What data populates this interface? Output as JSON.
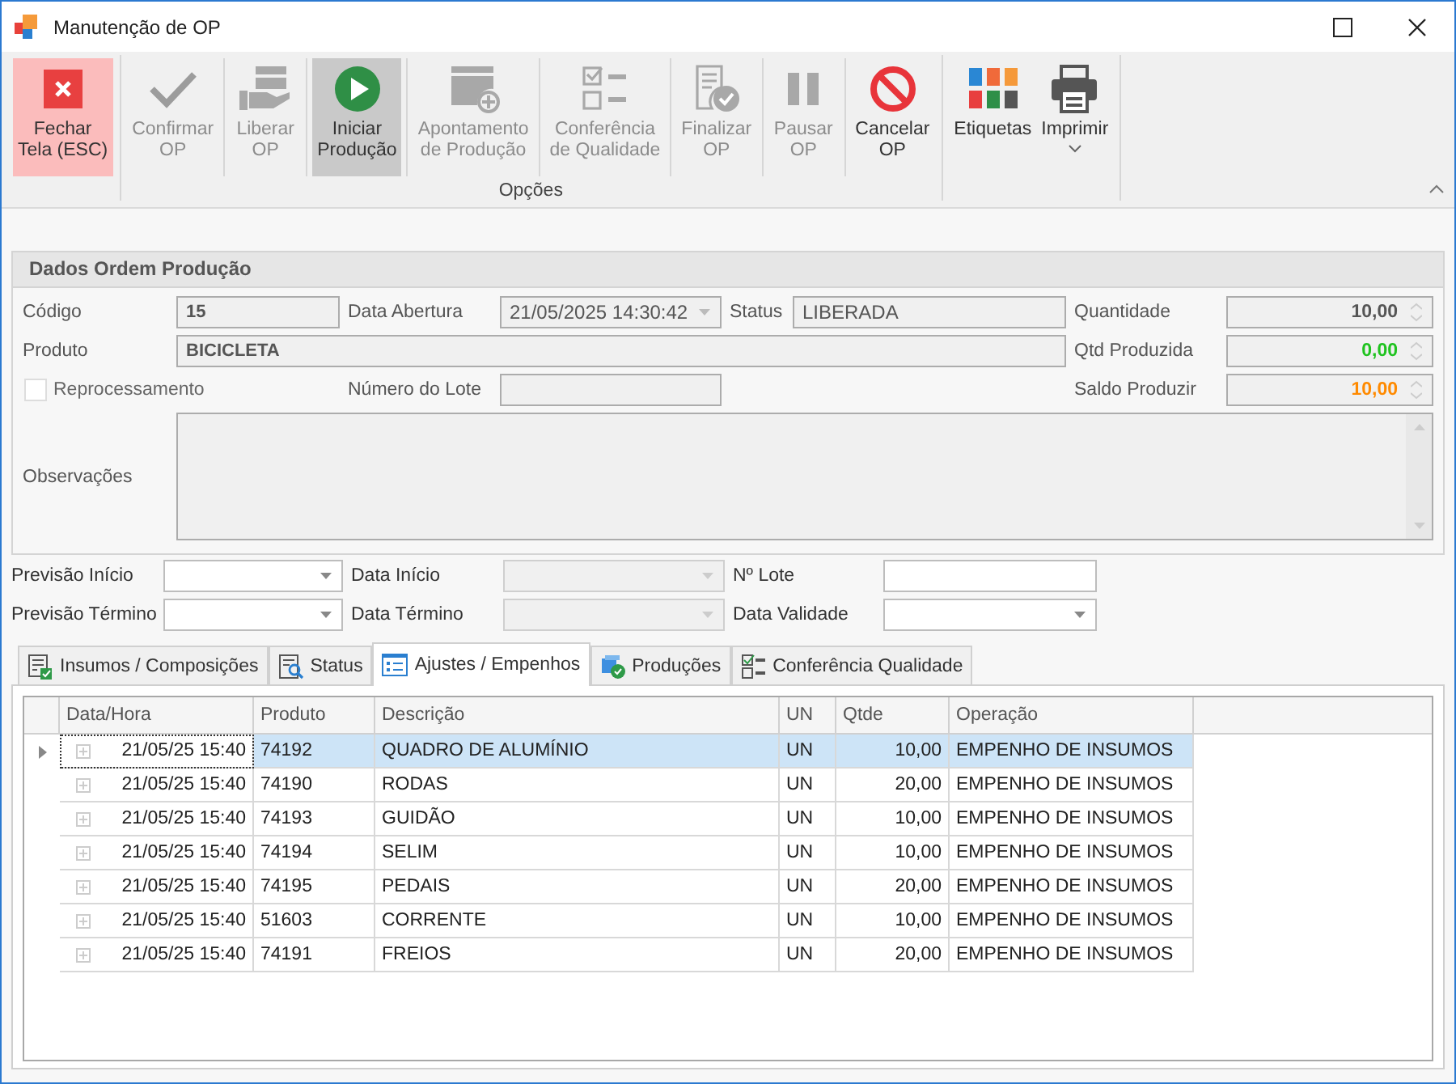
{
  "window": {
    "title": "Manutenção de OP"
  },
  "ribbon": {
    "groups": [
      {
        "buttons": [
          {
            "label": [
              "Fechar",
              "Tela (ESC)"
            ],
            "disabled": false,
            "hovered": true,
            "pressed": false
          }
        ]
      },
      {
        "label": "Opções",
        "buttons": [
          {
            "label": [
              "Confirmar",
              "OP"
            ],
            "disabled": true,
            "hovered": false,
            "pressed": false
          },
          {
            "label": [
              "Liberar",
              "OP"
            ],
            "disabled": true,
            "hovered": false,
            "pressed": false
          },
          {
            "label": [
              "Iniciar",
              "Produção"
            ],
            "disabled": false,
            "hovered": false,
            "pressed": true
          },
          {
            "label": [
              "Apontamento",
              "de Produção"
            ],
            "disabled": true,
            "hovered": false,
            "pressed": false
          },
          {
            "label": [
              "Conferência",
              "de Qualidade"
            ],
            "disabled": true,
            "hovered": false,
            "pressed": false
          },
          {
            "label": [
              "Finalizar",
              "OP"
            ],
            "disabled": true,
            "hovered": false,
            "pressed": false
          },
          {
            "label": [
              "Pausar",
              "OP"
            ],
            "disabled": true,
            "hovered": false,
            "pressed": false
          },
          {
            "label": [
              "Cancelar",
              "OP"
            ],
            "disabled": false,
            "hovered": false,
            "pressed": false
          }
        ]
      },
      {
        "buttons": [
          {
            "label": [
              "Etiquetas"
            ],
            "disabled": false,
            "hovered": false,
            "pressed": false
          },
          {
            "label": [
              "Imprimir"
            ],
            "disabled": false,
            "hovered": false,
            "pressed": false,
            "dropdown": true
          }
        ]
      }
    ]
  },
  "order": {
    "title": "Dados Ordem Produção",
    "code": {
      "label": "Código",
      "value": "15"
    },
    "opening_date": {
      "label": "Data Abertura",
      "value": "21/05/2025 14:30:42"
    },
    "status": {
      "label": "Status",
      "value": "LIBERADA"
    },
    "product": {
      "label": "Produto",
      "value": "BICICLETA"
    },
    "reprocessing": {
      "label": "Reprocessamento",
      "checked": false
    },
    "lot_number": {
      "label": "Número do Lote"
    },
    "notes": {
      "label": "Observações"
    },
    "quantities": [
      {
        "label": "Quantidade",
        "value": "10,00",
        "color": "#555555"
      },
      {
        "label": "Qtd Produzida",
        "value": "0,00",
        "color": "#1fc31f"
      },
      {
        "label": "Saldo Produzir",
        "value": "10,00",
        "color": "#ff8a00"
      }
    ]
  },
  "planning": [
    {
      "label": "Previsão Início",
      "kind": "dropdown",
      "disabled": false
    },
    {
      "label": "Data Início",
      "kind": "dropdown",
      "disabled": true
    },
    {
      "label": "Nº Lote",
      "kind": "text",
      "disabled": false
    },
    {
      "label": "Previsão Término",
      "kind": "dropdown",
      "disabled": false
    },
    {
      "label": "Data Término",
      "kind": "dropdown",
      "disabled": true
    },
    {
      "label": "Data Validade",
      "kind": "dropdown",
      "disabled": false
    }
  ],
  "tabs": [
    {
      "label": "Insumos / Composições",
      "selected": false
    },
    {
      "label": "Status",
      "selected": false
    },
    {
      "label": "Ajustes / Empenhos",
      "selected": true
    },
    {
      "label": "Produções",
      "selected": false
    },
    {
      "label": "Conferência Qualidade",
      "selected": false
    }
  ],
  "table": {
    "columns": [
      "Data/Hora",
      "Produto",
      "Descrição",
      "UN",
      "Qtde",
      "Operação"
    ],
    "rows": [
      {
        "cells": [
          "21/05/25 15:40",
          "74192",
          "QUADRO DE ALUMÍNIO",
          "UN",
          "10,00",
          "EMPENHO DE INSUMOS"
        ],
        "selected": true
      },
      {
        "cells": [
          "21/05/25 15:40",
          "74190",
          "RODAS",
          "UN",
          "20,00",
          "EMPENHO DE INSUMOS"
        ],
        "selected": false
      },
      {
        "cells": [
          "21/05/25 15:40",
          "74193",
          "GUIDÃO",
          "UN",
          "10,00",
          "EMPENHO DE INSUMOS"
        ],
        "selected": false
      },
      {
        "cells": [
          "21/05/25 15:40",
          "74194",
          "SELIM",
          "UN",
          "10,00",
          "EMPENHO DE INSUMOS"
        ],
        "selected": false
      },
      {
        "cells": [
          "21/05/25 15:40",
          "74195",
          "PEDAIS",
          "UN",
          "20,00",
          "EMPENHO DE INSUMOS"
        ],
        "selected": false
      },
      {
        "cells": [
          "21/05/25 15:40",
          "51603",
          "CORRENTE",
          "UN",
          "10,00",
          "EMPENHO DE INSUMOS"
        ],
        "selected": false
      },
      {
        "cells": [
          "21/05/25 15:40",
          "74191",
          "FREIOS",
          "UN",
          "20,00",
          "EMPENHO DE INSUMOS"
        ],
        "selected": false
      }
    ]
  }
}
